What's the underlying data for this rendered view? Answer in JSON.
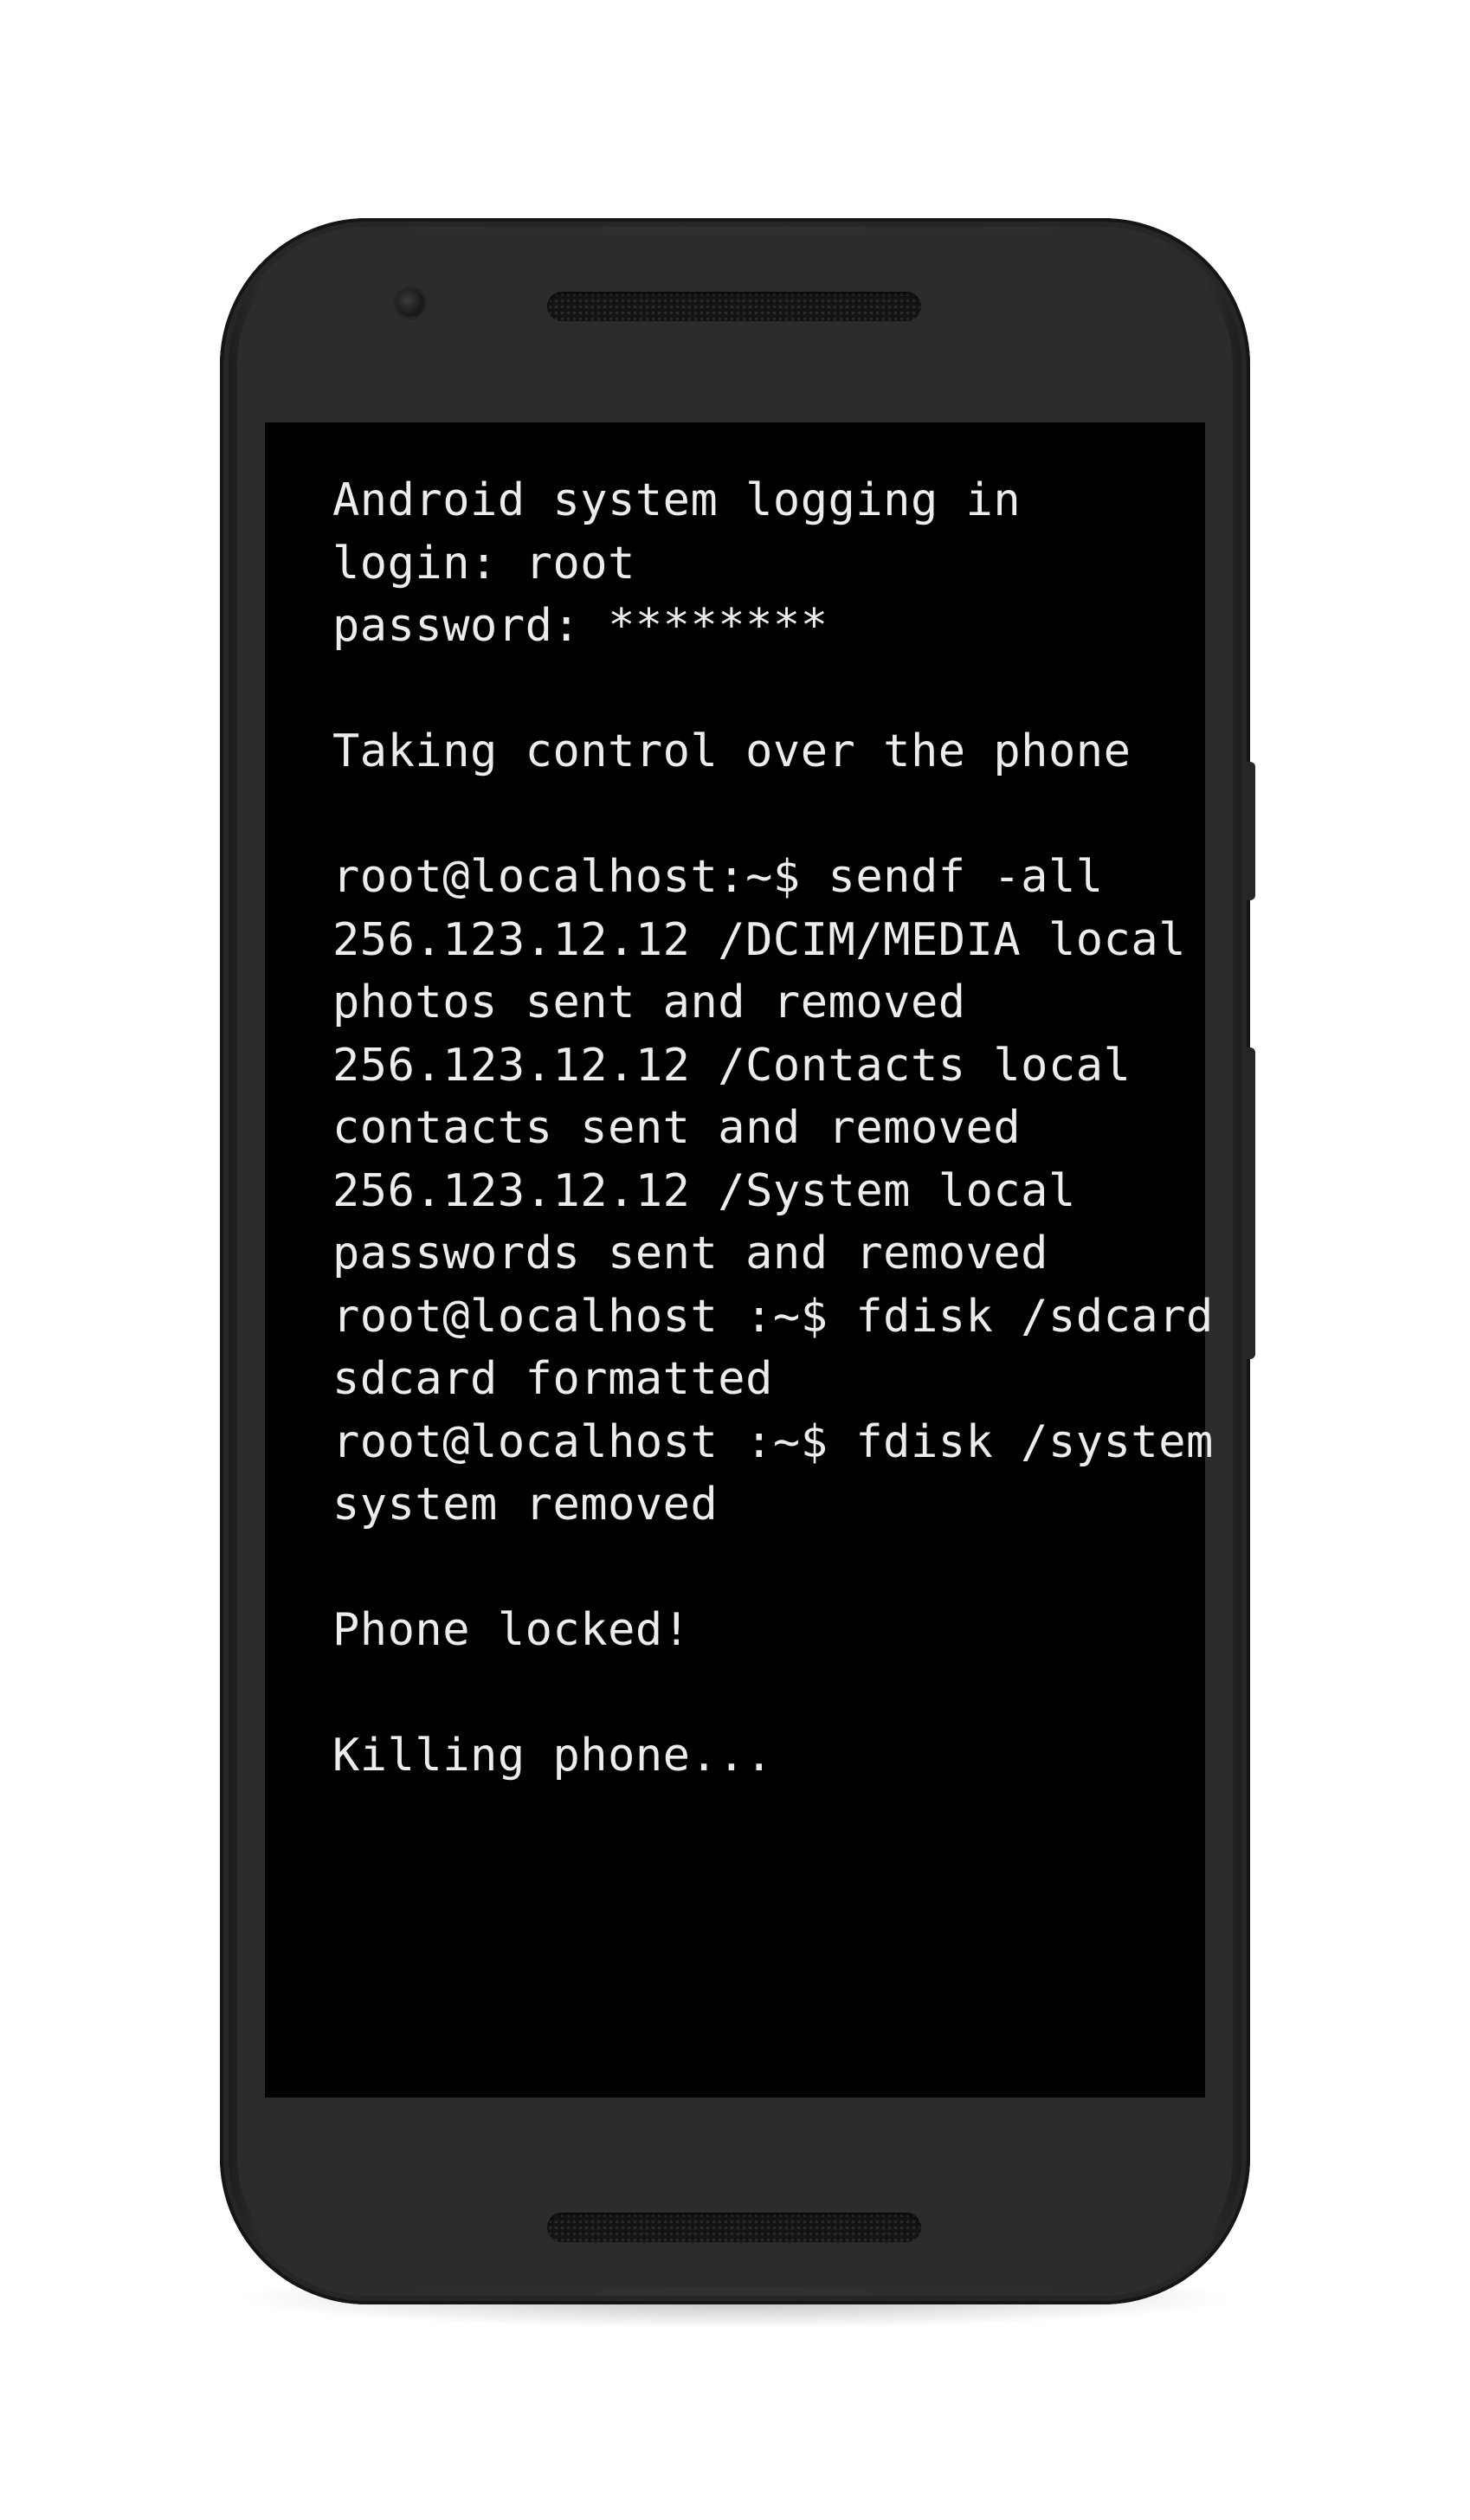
{
  "terminal": {
    "lines": [
      "Android system logging in",
      "login: root",
      "password: ********",
      "",
      "Taking control over the phone",
      "",
      "root@localhost:~$ sendf -all",
      "256.123.12.12 /DCIM/MEDIA local",
      "photos sent and removed",
      "256.123.12.12 /Contacts local",
      "contacts sent and removed",
      "256.123.12.12 /System local",
      "passwords sent and removed",
      "root@localhost :~$ fdisk /sdcard",
      "sdcard formatted",
      "root@localhost :~$ fdisk /system",
      "system removed",
      "",
      "Phone locked!",
      "",
      "Killing phone..."
    ]
  },
  "colors": {
    "screen_background": "#000000",
    "terminal_text": "#ececec",
    "phone_body": "#2c2c2c"
  }
}
